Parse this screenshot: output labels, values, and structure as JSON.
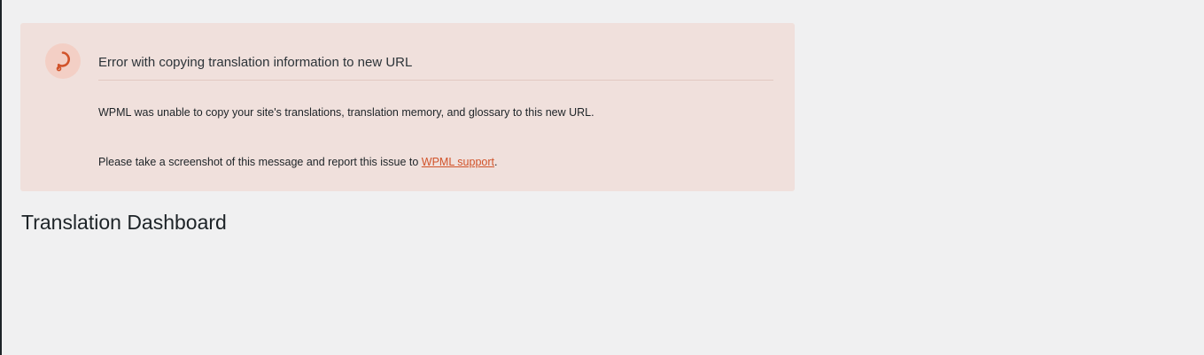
{
  "notice": {
    "icon": "wpml-error-icon",
    "accent_color": "#d1532a",
    "background_color": "#f0e0dc",
    "title": "Error with copying translation information to new URL",
    "message": "WPML was unable to copy your site's translations, translation memory, and glossary to this new URL.",
    "instruction_prefix": "Please take a screenshot of this message and report this issue to ",
    "support_link_text": "WPML support",
    "instruction_suffix": "."
  },
  "page": {
    "title": "Translation Dashboard"
  }
}
